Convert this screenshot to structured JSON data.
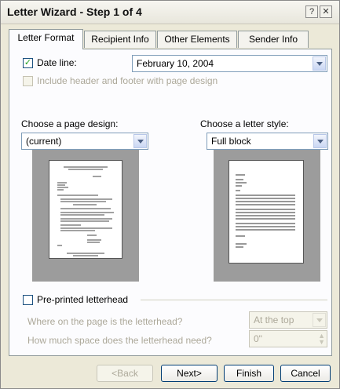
{
  "window": {
    "title": "Letter Wizard - Step 1 of 4",
    "help_glyph": "?",
    "close_glyph": "✕"
  },
  "tabs": [
    {
      "label": "Letter Format"
    },
    {
      "label": "Recipient Info"
    },
    {
      "label": "Other Elements"
    },
    {
      "label": "Sender Info"
    }
  ],
  "date_line": {
    "label": "Date line:",
    "checked": true,
    "value": "February 10, 2004"
  },
  "include_header": {
    "label": "Include header and footer with page design",
    "checked": false
  },
  "page_design": {
    "label": "Choose a page design:",
    "value": "(current)"
  },
  "letter_style": {
    "label": "Choose a letter style:",
    "value": "Full block"
  },
  "letterhead": {
    "label": "Pre-printed letterhead",
    "where_label": "Where on the page is the letterhead?",
    "where_value": "At the top",
    "space_label": "How much space does the letterhead need?",
    "space_value": "0\""
  },
  "buttons": {
    "back": "<Back",
    "next": "Next>",
    "finish": "Finish",
    "cancel": "Cancel"
  },
  "icons": {
    "check": "check-icon",
    "dropdown": "chevron-down-icon"
  }
}
